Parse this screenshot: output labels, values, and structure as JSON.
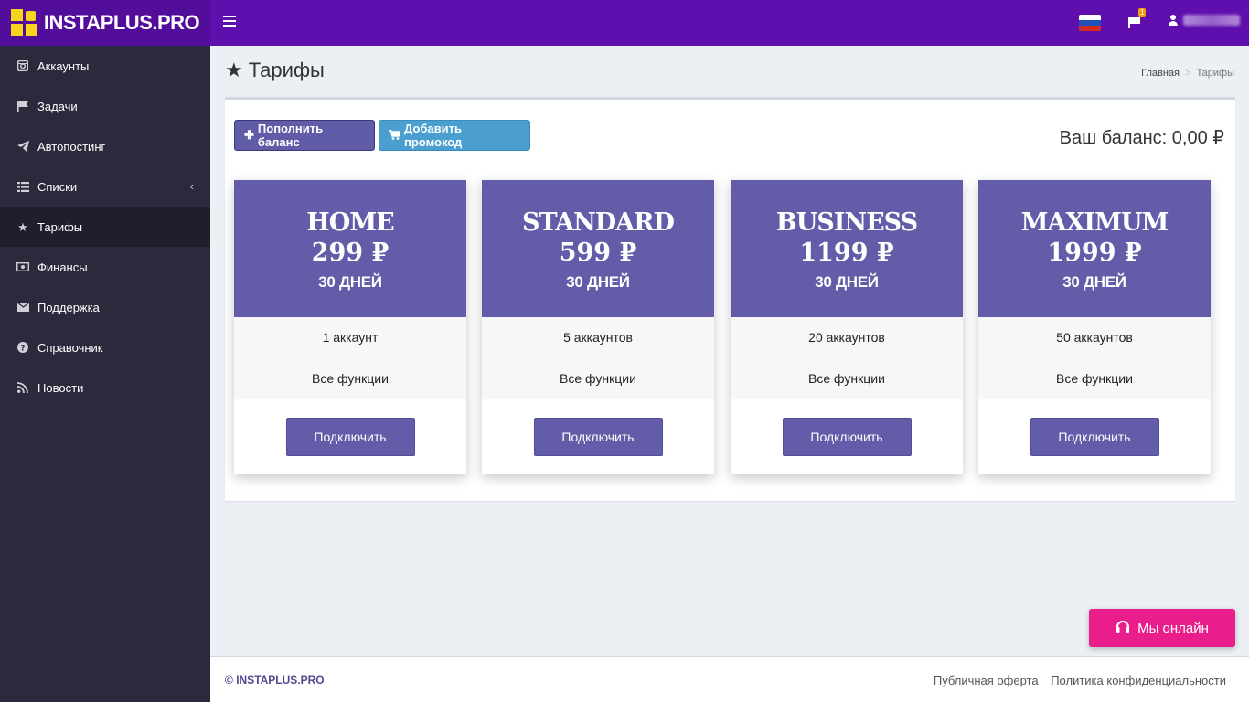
{
  "brand": {
    "name": "INSTAPLUS.PRO"
  },
  "colors": {
    "topbar": "#5e0fae",
    "sidebar": "#2a2a3c",
    "accent": "#635ca8",
    "promo": "#4a9fd0",
    "online": "#e91e8c"
  },
  "header": {
    "notifications_count": "1",
    "language": "ru"
  },
  "sidebar": {
    "items": [
      {
        "label": "Аккаунты",
        "icon": "instagram-icon"
      },
      {
        "label": "Задачи",
        "icon": "flag-icon"
      },
      {
        "label": "Автопостинг",
        "icon": "paper-plane-icon"
      },
      {
        "label": "Списки",
        "icon": "list-icon"
      },
      {
        "label": "Тарифы",
        "icon": "star-icon"
      },
      {
        "label": "Финансы",
        "icon": "money-icon"
      },
      {
        "label": "Поддержка",
        "icon": "envelope-icon"
      },
      {
        "label": "Справочник",
        "icon": "question-icon"
      },
      {
        "label": "Новости",
        "icon": "rss-icon"
      }
    ]
  },
  "page": {
    "title": "Тарифы",
    "breadcrumb": {
      "home": "Главная",
      "current": "Тарифы"
    }
  },
  "toolbar": {
    "topup_label": "Пополнить баланс",
    "promo_label": "Добавить промокод",
    "balance_text": "Ваш баланс: 0,00 ₽"
  },
  "plans": [
    {
      "name": "HOME",
      "price": "299 ₽",
      "days": "30 ДНЕЙ",
      "accounts": "1 аккаунт",
      "features": "Все функции",
      "button": "Подключить"
    },
    {
      "name": "STANDARD",
      "price": "599 ₽",
      "days": "30 ДНЕЙ",
      "accounts": "5 аккаунтов",
      "features": "Все функции",
      "button": "Подключить"
    },
    {
      "name": "BUSINESS",
      "price": "1199 ₽",
      "days": "30 ДНЕЙ",
      "accounts": "20 аккаунтов",
      "features": "Все функции",
      "button": "Подключить"
    },
    {
      "name": "MAXIMUM",
      "price": "1999 ₽",
      "days": "30 ДНЕЙ",
      "accounts": "50 аккаунтов",
      "features": "Все функции",
      "button": "Подключить"
    }
  ],
  "footer": {
    "copyright_symbol": "©",
    "copyright_brand": "INSTAPLUS.PRO",
    "links": [
      "Публичная оферта",
      "Политика конфиденциальности"
    ]
  },
  "chat": {
    "label": "Мы онлайн"
  }
}
